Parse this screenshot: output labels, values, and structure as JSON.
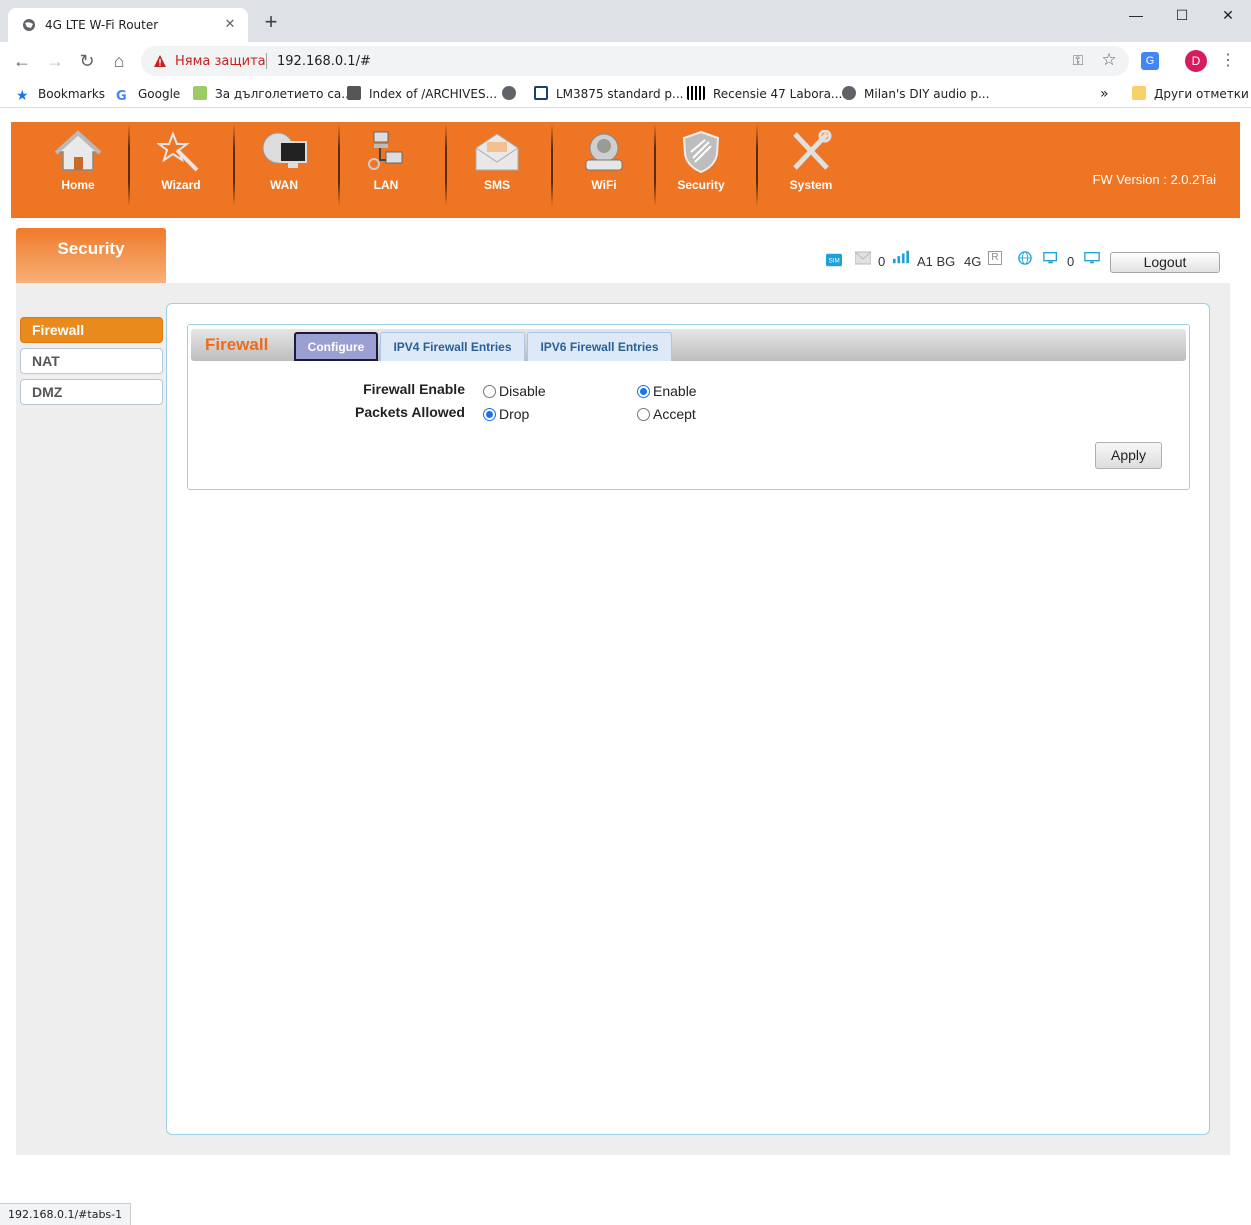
{
  "browser": {
    "tab_title": "4G LTE W-Fi Router",
    "tab_close": "✕",
    "new_tab": "+",
    "window_controls": {
      "minimize": "—",
      "maximize": "☐",
      "close": "✕"
    },
    "security_text": "Няма защита",
    "url": "192.168.0.1/#",
    "avatar_letter": "D",
    "bookmarks": [
      {
        "label": "Bookmarks",
        "icon": "star-icon"
      },
      {
        "label": "Google",
        "icon": "google-icon"
      },
      {
        "label": "За дълголетието са...",
        "icon": "page-icon"
      },
      {
        "label": "Index of /ARCHIVES...",
        "icon": "page-icon"
      },
      {
        "label": "",
        "icon": "globe-icon"
      },
      {
        "label": "LM3875 standard p...",
        "icon": "grid-icon"
      },
      {
        "label": "Recensie 47 Labora...",
        "icon": "logo-icon"
      },
      {
        "label": "Milan's DIY audio p...",
        "icon": "globe-icon"
      }
    ],
    "bookmarks_overflow": "»",
    "other_bookmarks": "Други отметки",
    "status_url": "192.168.0.1/#tabs-1"
  },
  "router": {
    "nav": [
      {
        "label": "Home",
        "icon": "home-icon"
      },
      {
        "label": "Wizard",
        "icon": "wizard-wand-icon"
      },
      {
        "label": "WAN",
        "icon": "wan-globe-monitor-icon"
      },
      {
        "label": "LAN",
        "icon": "lan-computers-icon"
      },
      {
        "label": "SMS",
        "icon": "envelope-icon"
      },
      {
        "label": "WiFi",
        "icon": "wifi-router-icon"
      },
      {
        "label": "Security",
        "icon": "shield-icon"
      },
      {
        "label": "System",
        "icon": "tools-icon"
      }
    ],
    "fw_version": "FW Version : 2.0.2Tai",
    "section_title": "Security",
    "status": {
      "sms_count": "0",
      "operator": "A1 BG",
      "network": "4G",
      "roaming": "R",
      "clients": "0",
      "logout": "Logout"
    },
    "sidemenu": [
      {
        "label": "Firewall",
        "active": true
      },
      {
        "label": "NAT",
        "active": false
      },
      {
        "label": "DMZ",
        "active": false
      }
    ],
    "firewall": {
      "title": "Firewall",
      "tabs": [
        {
          "label": "Configure",
          "active": true
        },
        {
          "label": "IPV4 Firewall Entries",
          "active": false
        },
        {
          "label": "IPV6 Firewall Entries",
          "active": false
        }
      ],
      "enable_label": "Firewall Enable",
      "enable_options": [
        {
          "label": "Disable",
          "checked": false
        },
        {
          "label": "Enable",
          "checked": true
        }
      ],
      "packets_label": "Packets Allowed",
      "packets_options": [
        {
          "label": "Drop",
          "checked": true
        },
        {
          "label": "Accept",
          "checked": false
        }
      ],
      "apply": "Apply"
    },
    "colors": {
      "brand": "#ee7524",
      "active_menu": "#e98a1c",
      "panel_border": "#9bd0e6"
    }
  }
}
